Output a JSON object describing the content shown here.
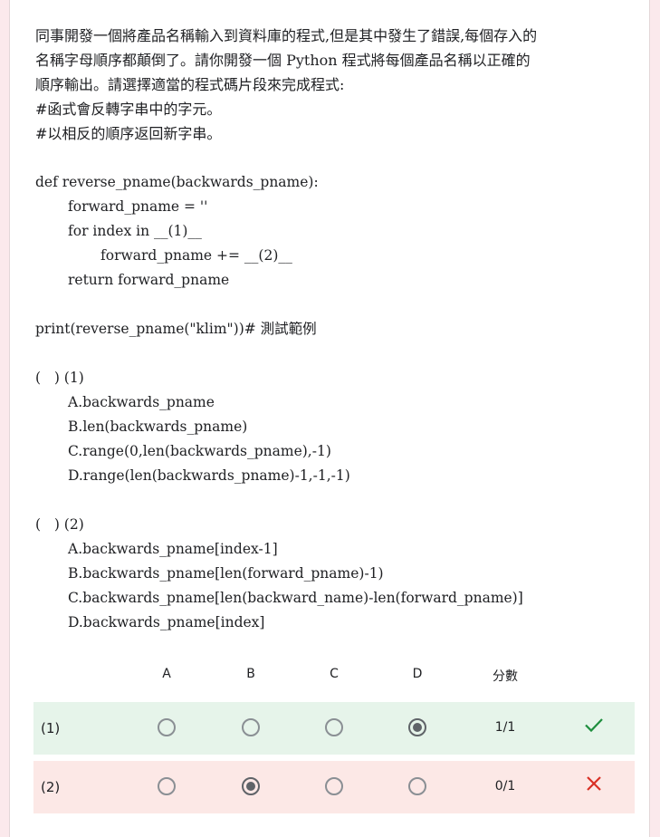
{
  "question": {
    "lines": [
      "同事開發一個將產品名稱輸入到資料庫的程式,但是其中發生了錯誤,每個存入的",
      "名稱字母順序都顛倒了。請你開發一個 Python 程式將每個產品名稱以正確的",
      "順序輸出。請選擇適當的程式碼片段來完成程式:",
      "#函式會反轉字串中的字元。",
      "#以相反的順序返回新字串。"
    ],
    "code": {
      "def_line": "def reverse_pname(backwards_pname):",
      "assign_line": "forward_pname = ''",
      "for_line": "for index in __(1)__",
      "body_line": "forward_pname += __(2)__",
      "return_line": "return forward_pname",
      "print_line": "print(reverse_pname(\"klim\"))# 測試範例"
    },
    "sub1": {
      "label": "(   ) (1)",
      "options": [
        "A.backwards_pname",
        "B.len(backwards_pname)",
        "C.range(0,len(backwards_pname),-1)",
        "D.range(len(backwards_pname)-1,-1,-1)"
      ]
    },
    "sub2": {
      "label": "(   ) (2)",
      "options": [
        "A.backwards_pname[index-1]",
        "B.backwards_pname[len(forward_pname)-1)",
        "C.backwards_pname[len(backward_name)-len(forward_pname)]",
        "D.backwards_pname[index]"
      ]
    }
  },
  "grid": {
    "columns": [
      "A",
      "B",
      "C",
      "D"
    ],
    "score_header": "分數",
    "rows": [
      {
        "label": "(1)",
        "selected": "D",
        "score": "1/1",
        "result": "correct"
      },
      {
        "label": "(2)",
        "selected": "B",
        "score": "0/1",
        "result": "wrong"
      }
    ]
  },
  "colors": {
    "correct_bg": "#e6f4ea",
    "wrong_bg": "#fce8e6",
    "check": "#1e8e3e",
    "cross": "#d93025"
  },
  "icons": {
    "row1_mark": "checkmark-icon",
    "row2_mark": "cross-icon"
  }
}
